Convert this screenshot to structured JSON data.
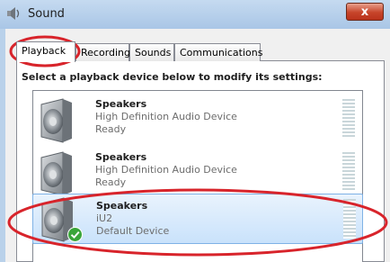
{
  "window": {
    "title": "Sound",
    "close_label": "x"
  },
  "tabs": [
    {
      "label": "Playback",
      "active": true
    },
    {
      "label": "Recording",
      "active": false
    },
    {
      "label": "Sounds",
      "active": false
    },
    {
      "label": "Communications",
      "active": false
    }
  ],
  "instruction": "Select a playback device below to modify its settings:",
  "devices": [
    {
      "name": "Speakers",
      "description": "High Definition Audio Device",
      "status": "Ready",
      "selected": false,
      "default": false
    },
    {
      "name": "Speakers",
      "description": "High Definition Audio Device",
      "status": "Ready",
      "selected": false,
      "default": false
    },
    {
      "name": "Speakers",
      "description": "iU2",
      "status": "Default Device",
      "selected": true,
      "default": true
    }
  ],
  "icons": {
    "title": "speaker-icon",
    "device": "speaker-icon",
    "default_badge": "green-check-icon"
  },
  "colors": {
    "annotation": "#d8242b",
    "selection": "#c9e2fb",
    "default_check": "#3aa53a"
  }
}
